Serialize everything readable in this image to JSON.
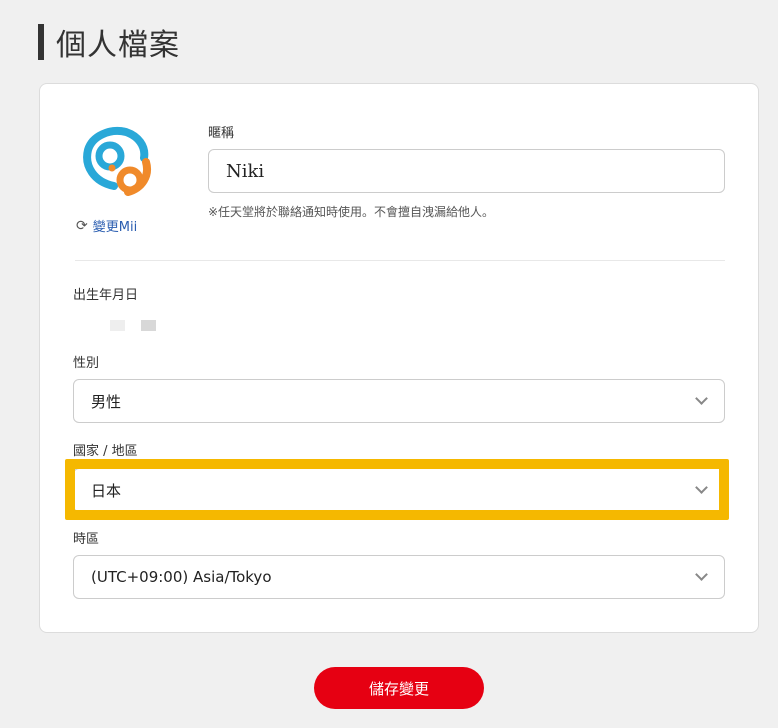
{
  "page": {
    "title": "個人檔案"
  },
  "profile": {
    "avatar_icon": "mii-avatar-icon",
    "change_mii_label": "變更Mii",
    "nickname_label": "暱稱",
    "nickname_value": "Niki",
    "nickname_note": "※任天堂將於聯絡通知時使用。不會擅自洩漏給他人。"
  },
  "birthdate": {
    "label": "出生年月日",
    "values": [
      "",
      ""
    ]
  },
  "gender": {
    "label": "性別",
    "selected": "男性"
  },
  "country": {
    "label": "國家 / 地區",
    "selected": "日本"
  },
  "timezone": {
    "label": "時區",
    "selected": "(UTC+09:00) Asia/Tokyo"
  },
  "actions": {
    "save_label": "儲存變更"
  },
  "colors": {
    "accent_red": "#e60012",
    "highlight_yellow": "#f5b800",
    "link_blue": "#2a5db0",
    "avatar_blue": "#29a8d8",
    "avatar_orange": "#f08a2a"
  }
}
